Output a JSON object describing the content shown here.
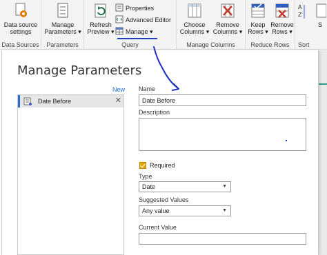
{
  "ribbon": {
    "groups": {
      "data_sources": "Data Sources",
      "parameters": "Parameters",
      "query": "Query",
      "manage_columns": "Manage Columns",
      "reduce_rows": "Reduce Rows",
      "sort": "Sort"
    },
    "buttons": {
      "data_source_settings": [
        "Data source",
        "settings"
      ],
      "manage_parameters": [
        "Manage",
        "Parameters ▾"
      ],
      "refresh_preview": [
        "Refresh",
        "Preview ▾"
      ],
      "properties": "Properties",
      "advanced_editor": "Advanced Editor",
      "manage": "Manage ▾",
      "choose_columns": [
        "Choose",
        "Columns ▾"
      ],
      "remove_columns": [
        "Remove",
        "Columns ▾"
      ],
      "keep_rows": [
        "Keep",
        "Rows ▾"
      ],
      "remove_rows": [
        "Remove",
        "Rows ▾"
      ],
      "sort_partial": "S"
    },
    "colors": {
      "accent": "#1f3fbf",
      "excel_green": "#217346",
      "remove_red": "#c0392b"
    }
  },
  "dialog": {
    "title": "Manage Parameters",
    "new_link": "New",
    "parameters": [
      {
        "name": "Date Before",
        "close": "✕"
      }
    ],
    "fields": {
      "name_label": "Name",
      "name_value": "Date Before",
      "description_label": "Description",
      "description_value": "",
      "required_label": "Required",
      "required_checked": true,
      "type_label": "Type",
      "type_value": "Date",
      "suggested_label": "Suggested Values",
      "suggested_value": "Any value",
      "current_label": "Current Value",
      "current_value": ""
    }
  }
}
